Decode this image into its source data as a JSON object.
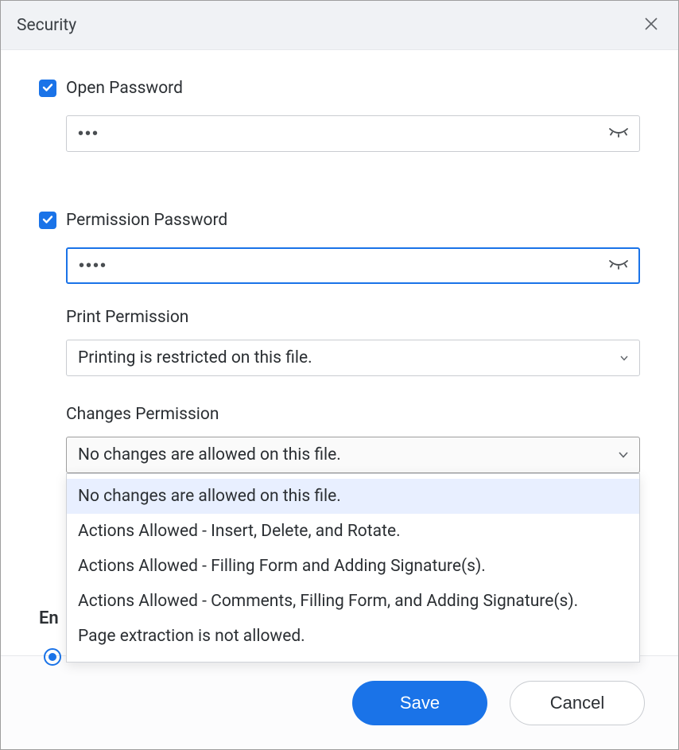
{
  "dialog": {
    "title": "Security"
  },
  "open_password": {
    "label": "Open Password",
    "value": "•••"
  },
  "permission_password": {
    "label": "Permission Password",
    "value": "••••"
  },
  "print_permission": {
    "label": "Print Permission",
    "selected": "Printing is restricted on this file."
  },
  "changes_permission": {
    "label": "Changes Permission",
    "selected": "No changes are allowed on this file.",
    "options": [
      "No changes are allowed on this file.",
      "Actions Allowed - Insert, Delete, and Rotate.",
      "Actions Allowed - Filling Form and Adding Signature(s).",
      "Actions Allowed - Comments, Filling Form, and Adding Signature(s).",
      "Page extraction is not allowed."
    ]
  },
  "partial": {
    "label_fragment": "En"
  },
  "buttons": {
    "save": "Save",
    "cancel": "Cancel"
  }
}
